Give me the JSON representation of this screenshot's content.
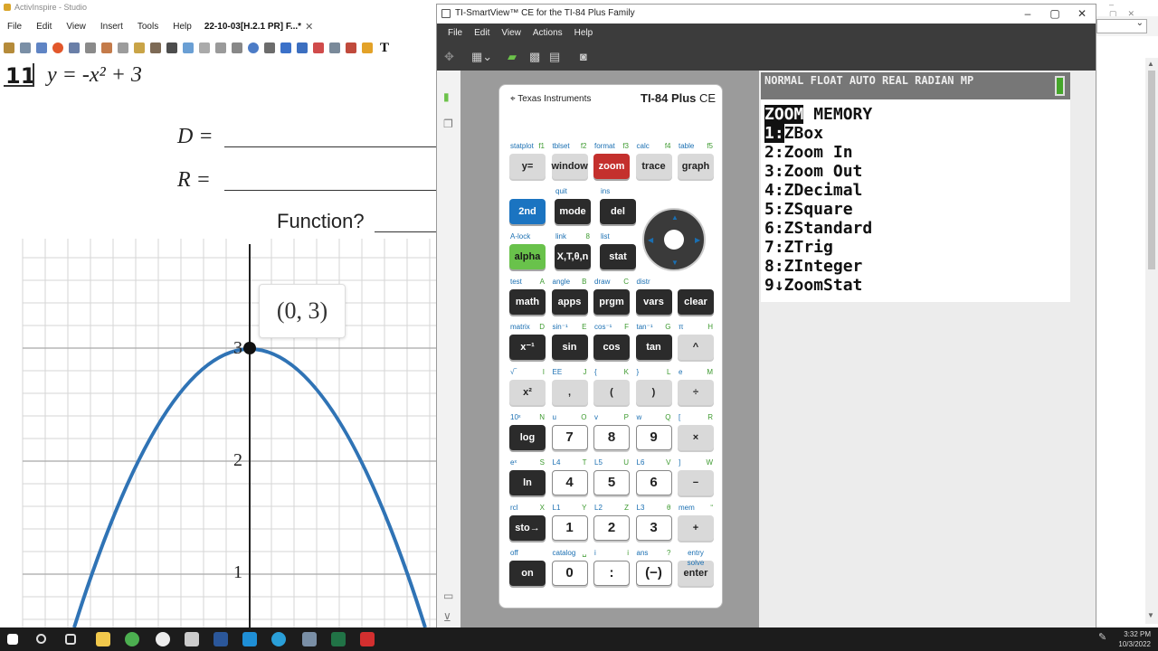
{
  "activinspire": {
    "title": "ActivInspire - Studio",
    "menu": [
      "File",
      "Edit",
      "View",
      "Insert",
      "Tools",
      "Help"
    ],
    "tab_label": "22-10-03[H.2.1 PR] F...*",
    "question_number": "11",
    "equation": "y = -x² + 3",
    "domain_label": "D =",
    "range_label": "R =",
    "function_label": "Function?",
    "point_label": "(0, 3)",
    "graph_ticks": [
      "3",
      "2",
      "1"
    ]
  },
  "smartview": {
    "title": "TI-SmartView™ CE for the TI-84 Plus Family",
    "menu": [
      "File",
      "Edit",
      "View",
      "Actions",
      "Help"
    ],
    "calculator": {
      "brand": "Texas Instruments",
      "model": "TI-84 Plus",
      "model_suffix": "CE",
      "rows": [
        [
          [
            "statplot",
            "f1",
            "y="
          ],
          [
            "tblset",
            "f2",
            "window"
          ],
          [
            "format",
            "f3",
            "zoom"
          ],
          [
            "calc",
            "f4",
            "trace"
          ],
          [
            "table",
            "f5",
            "graph"
          ]
        ],
        [
          [
            "",
            "",
            "2nd"
          ],
          [
            "quit",
            "",
            "mode"
          ],
          [
            "ins",
            "",
            "del"
          ]
        ],
        [
          [
            "A-lock",
            "",
            "alpha"
          ],
          [
            "link",
            "8",
            "X,T,θ,n"
          ],
          [
            "list",
            "",
            "stat"
          ]
        ],
        [
          [
            "test",
            "A",
            "math"
          ],
          [
            "angle",
            "B",
            "apps"
          ],
          [
            "draw",
            "C",
            "prgm"
          ],
          [
            "distr",
            "",
            "vars"
          ],
          [
            "",
            "",
            "clear"
          ]
        ],
        [
          [
            "matrix",
            "D",
            "x⁻¹"
          ],
          [
            "sin⁻¹",
            "E",
            "sin"
          ],
          [
            "cos⁻¹",
            "F",
            "cos"
          ],
          [
            "tan⁻¹",
            "G",
            "tan"
          ],
          [
            "π",
            "H",
            "^"
          ]
        ],
        [
          [
            "√‾",
            "I",
            "x²"
          ],
          [
            "EE",
            "J",
            ","
          ],
          [
            "{",
            "K",
            "("
          ],
          [
            "}",
            "L",
            ")"
          ],
          [
            "e",
            "M",
            "÷"
          ]
        ],
        [
          [
            "10ˣ",
            "N",
            "log"
          ],
          [
            "u",
            "O",
            "7"
          ],
          [
            "v",
            "P",
            "8"
          ],
          [
            "w",
            "Q",
            "9"
          ],
          [
            "[",
            "R",
            "×"
          ]
        ],
        [
          [
            "eˣ",
            "S",
            "ln"
          ],
          [
            "L4",
            "T",
            "4"
          ],
          [
            "L5",
            "U",
            "5"
          ],
          [
            "L6",
            "V",
            "6"
          ],
          [
            "]",
            "W",
            "−"
          ]
        ],
        [
          [
            "rcl",
            "X",
            "sto→"
          ],
          [
            "L1",
            "Y",
            "1"
          ],
          [
            "L2",
            "Z",
            "2"
          ],
          [
            "L3",
            "θ",
            "3"
          ],
          [
            "mem",
            "“",
            "+"
          ]
        ],
        [
          [
            "off",
            "",
            "on"
          ],
          [
            "catalog",
            "␣",
            "0"
          ],
          [
            "i",
            "i",
            ":"
          ],
          [
            "ans",
            "?",
            "(−)"
          ],
          [
            "entry solve",
            "",
            "enter"
          ]
        ]
      ]
    },
    "screen": {
      "status": "NORMAL FLOAT AUTO REAL RADIAN MP",
      "menu_tab_active": "ZOOM",
      "menu_tab": "MEMORY",
      "items": [
        "1:ZBox",
        "2:Zoom In",
        "3:Zoom Out",
        "4:ZDecimal",
        "5:ZSquare",
        "6:ZStandard",
        "7:ZTrig",
        "8:ZInteger",
        "9↓ZoomStat"
      ]
    }
  },
  "taskbar": {
    "time": "3:32 PM",
    "date": "10/3/2022"
  }
}
